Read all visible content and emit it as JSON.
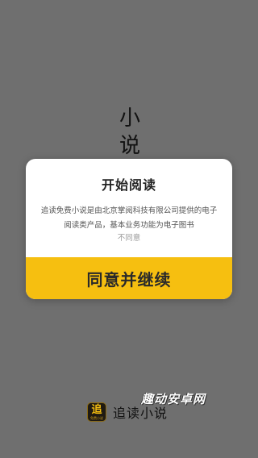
{
  "splash": {
    "title_line1": "小",
    "title_line2": "说"
  },
  "dialog": {
    "title": "开始阅读",
    "body": "追读免费小说是由北京掌阅科技有限公司提供的电子阅读类产品，基本业务功能为电子图书",
    "disagree_label": "不同意",
    "agree_label": "同意并继续"
  },
  "brand": {
    "logo_icon": "zhuidu-logo-icon",
    "logo_glyph": "追",
    "logo_sub": "免费小说",
    "name": "追读小说"
  },
  "watermark": {
    "text": "趣动安卓网"
  },
  "colors": {
    "background": "#6f6f6f",
    "accent": "#f6bf10",
    "dialog_bg": "#ffffff"
  }
}
